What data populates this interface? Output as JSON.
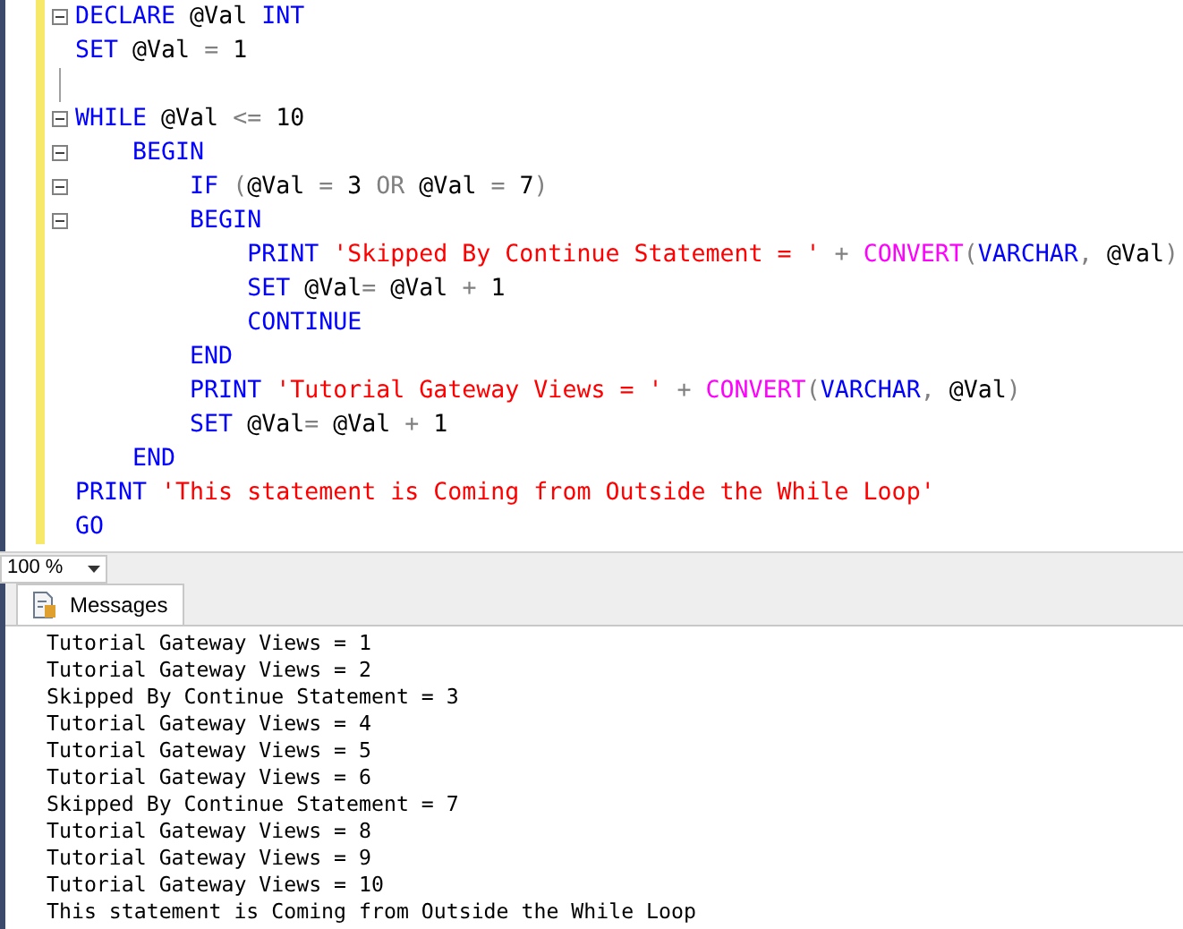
{
  "editor": {
    "lines": [
      {
        "fold": true,
        "tokens": [
          {
            "kind": "keyword",
            "text": "DECLARE"
          },
          {
            "kind": "plain",
            "text": " @Val "
          },
          {
            "kind": "keyword",
            "text": "INT"
          }
        ]
      },
      {
        "fold": false,
        "tokens": [
          {
            "kind": "keyword",
            "text": "SET"
          },
          {
            "kind": "plain",
            "text": " @Val "
          },
          {
            "kind": "op",
            "text": "="
          },
          {
            "kind": "plain",
            "text": " 1"
          }
        ]
      },
      {
        "kind": "blank"
      },
      {
        "fold": true,
        "tokens": [
          {
            "kind": "keyword",
            "text": "WHILE"
          },
          {
            "kind": "plain",
            "text": " @Val "
          },
          {
            "kind": "op",
            "text": "<="
          },
          {
            "kind": "plain",
            "text": " 10"
          }
        ]
      },
      {
        "fold": true,
        "tokens": [
          {
            "kind": "keyword",
            "text": "    BEGIN"
          }
        ]
      },
      {
        "fold": true,
        "tokens": [
          {
            "kind": "keyword",
            "text": "        IF"
          },
          {
            "kind": "op",
            "text": " ("
          },
          {
            "kind": "plain",
            "text": "@Val "
          },
          {
            "kind": "op",
            "text": "="
          },
          {
            "kind": "plain",
            "text": " 3 "
          },
          {
            "kind": "op",
            "text": "OR"
          },
          {
            "kind": "plain",
            "text": " @Val "
          },
          {
            "kind": "op",
            "text": "="
          },
          {
            "kind": "plain",
            "text": " 7"
          },
          {
            "kind": "op",
            "text": ")"
          }
        ]
      },
      {
        "fold": true,
        "tokens": [
          {
            "kind": "keyword",
            "text": "        BEGIN"
          }
        ]
      },
      {
        "fold": false,
        "tokens": [
          {
            "kind": "keyword",
            "text": "            PRINT"
          },
          {
            "kind": "string",
            "text": " 'Skipped By Continue Statement = '"
          },
          {
            "kind": "op",
            "text": " + "
          },
          {
            "kind": "func",
            "text": "CONVERT"
          },
          {
            "kind": "op",
            "text": "("
          },
          {
            "kind": "keyword",
            "text": "VARCHAR"
          },
          {
            "kind": "op",
            "text": ", "
          },
          {
            "kind": "plain",
            "text": "@Val"
          },
          {
            "kind": "op",
            "text": ")"
          }
        ]
      },
      {
        "fold": false,
        "tokens": [
          {
            "kind": "keyword",
            "text": "            SET"
          },
          {
            "kind": "plain",
            "text": " @Val"
          },
          {
            "kind": "op",
            "text": "="
          },
          {
            "kind": "plain",
            "text": " @Val "
          },
          {
            "kind": "op",
            "text": "+"
          },
          {
            "kind": "plain",
            "text": " 1"
          }
        ]
      },
      {
        "fold": false,
        "tokens": [
          {
            "kind": "keyword",
            "text": "            CONTINUE"
          }
        ]
      },
      {
        "fold": false,
        "tokens": [
          {
            "kind": "keyword",
            "text": "        END"
          }
        ]
      },
      {
        "fold": false,
        "tokens": [
          {
            "kind": "keyword",
            "text": "        PRINT"
          },
          {
            "kind": "string",
            "text": " 'Tutorial Gateway Views = '"
          },
          {
            "kind": "op",
            "text": " + "
          },
          {
            "kind": "func",
            "text": "CONVERT"
          },
          {
            "kind": "op",
            "text": "("
          },
          {
            "kind": "keyword",
            "text": "VARCHAR"
          },
          {
            "kind": "op",
            "text": ", "
          },
          {
            "kind": "plain",
            "text": "@Val"
          },
          {
            "kind": "op",
            "text": ")"
          }
        ]
      },
      {
        "fold": false,
        "tokens": [
          {
            "kind": "keyword",
            "text": "        SET"
          },
          {
            "kind": "plain",
            "text": " @Val"
          },
          {
            "kind": "op",
            "text": "="
          },
          {
            "kind": "plain",
            "text": " @Val "
          },
          {
            "kind": "op",
            "text": "+"
          },
          {
            "kind": "plain",
            "text": " 1"
          }
        ]
      },
      {
        "fold": false,
        "tokens": [
          {
            "kind": "keyword",
            "text": "    END"
          }
        ]
      },
      {
        "fold": false,
        "tokens": [
          {
            "kind": "keyword",
            "text": "PRINT"
          },
          {
            "kind": "string",
            "text": " 'This statement is Coming from Outside the While Loop'"
          }
        ]
      },
      {
        "fold": false,
        "tokens": [
          {
            "kind": "keyword",
            "text": "GO"
          }
        ]
      }
    ]
  },
  "zoom": {
    "value": "100 %"
  },
  "results": {
    "tab": {
      "label": "Messages",
      "selected": true
    },
    "messages": [
      "Tutorial Gateway Views = 1",
      "Tutorial Gateway Views = 2",
      "Skipped By Continue Statement = 3",
      "Tutorial Gateway Views = 4",
      "Tutorial Gateway Views = 5",
      "Tutorial Gateway Views = 6",
      "Skipped By Continue Statement = 7",
      "Tutorial Gateway Views = 8",
      "Tutorial Gateway Views = 9",
      "Tutorial Gateway Views = 10",
      "This statement is Coming from Outside the While Loop"
    ]
  }
}
